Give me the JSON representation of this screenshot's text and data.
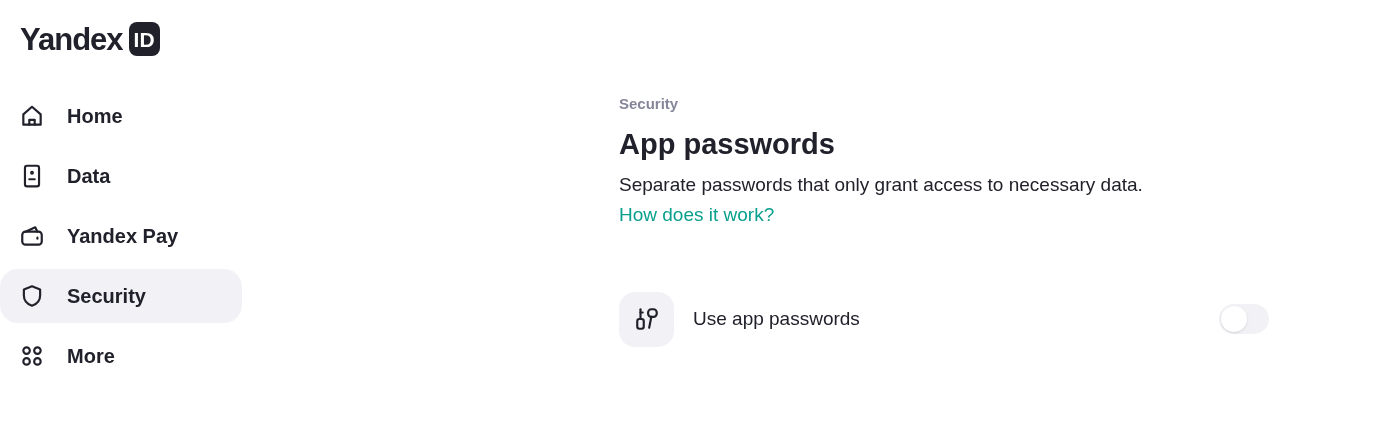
{
  "logo": {
    "text": "Yandex",
    "badge": "ID"
  },
  "sidebar": {
    "items": [
      {
        "label": "Home",
        "selected": false
      },
      {
        "label": "Data",
        "selected": false
      },
      {
        "label": "Yandex Pay",
        "selected": false
      },
      {
        "label": "Security",
        "selected": true
      },
      {
        "label": "More",
        "selected": false
      }
    ]
  },
  "breadcrumb": "Security",
  "title": "App passwords",
  "description": {
    "text": "Separate passwords that only grant access to necessary data.",
    "link": "How does it work?"
  },
  "setting": {
    "label": "Use app passwords",
    "on": false
  }
}
